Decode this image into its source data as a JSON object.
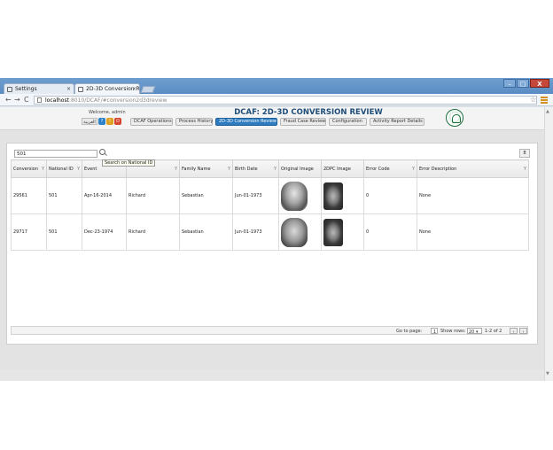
{
  "browser": {
    "tabs": [
      {
        "label": "Settings",
        "close": "×"
      },
      {
        "label": "2D-3D Conversion R",
        "close": "×"
      }
    ],
    "window_controls": {
      "minimize": "–",
      "maximize": "□",
      "close": "X"
    },
    "nav": {
      "back": "←",
      "forward": "→",
      "reload": "C"
    },
    "address": {
      "host": "localhost",
      "path": ":8010/DCAF/#conversion2d3dreview"
    }
  },
  "header": {
    "welcome": "Welcome, admin",
    "language": "العربية",
    "title": "DCAF: 2D-3D CONVERSION REVIEW",
    "nav_tabs": [
      {
        "label": "DCAF Operations"
      },
      {
        "label": "Process History"
      },
      {
        "label": "2D-3D Conversion Review"
      },
      {
        "label": "Fraud Case Review"
      },
      {
        "label": "Configuration"
      },
      {
        "label": "Activity Report Details"
      }
    ]
  },
  "search": {
    "value": "501",
    "tooltip": "Search on National ID"
  },
  "grid": {
    "columns": [
      {
        "label": "Conversion"
      },
      {
        "label": "National ID"
      },
      {
        "label": "Event"
      },
      {
        "label": ""
      },
      {
        "label": "Family Name"
      },
      {
        "label": "Birth Date"
      },
      {
        "label": "Original Image"
      },
      {
        "label": "2DPC Image"
      },
      {
        "label": "Error Code"
      },
      {
        "label": "Error Description"
      }
    ],
    "rows": [
      {
        "conversion": "29561",
        "national_id": "501",
        "event": "Apr-16-2014",
        "given_name": "Richard",
        "family_name": "Sebastian",
        "birth_date": "Jun-01-1973",
        "error_code": "0",
        "error_description": "None"
      },
      {
        "conversion": "29717",
        "national_id": "501",
        "event": "Dec-23-1974",
        "given_name": "Richard",
        "family_name": "Sebastian",
        "birth_date": "Jun-01-1973",
        "error_code": "0",
        "error_description": "None"
      }
    ]
  },
  "pager": {
    "go_to_label": "Go to page:",
    "page": "1",
    "show_rows_label": "Show rows:",
    "rows_per_page": "20",
    "range": "1-2 of 2",
    "prev": "‹",
    "next": "›"
  },
  "colors": {
    "accent": "#2e7bbf",
    "title": "#1f4e79",
    "chrome": "#5a8bc3"
  }
}
